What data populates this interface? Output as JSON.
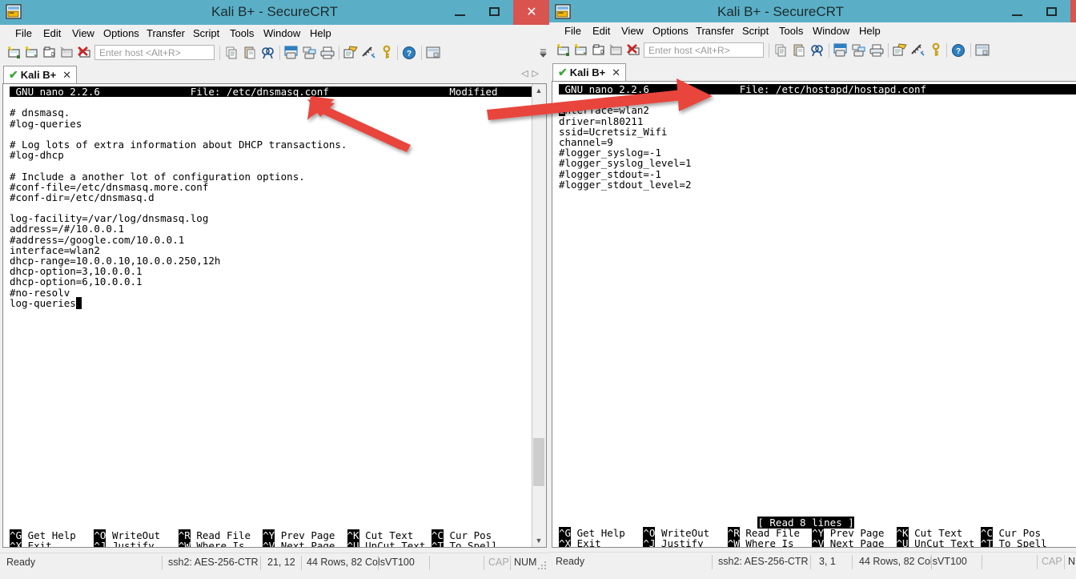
{
  "theme": {
    "titlebar_bg": "#5aafc6",
    "close_btn_bg": "#d9534f",
    "desktop_bg": "#8ec9d8",
    "terminal_bg": "#ffffff",
    "terminal_fg": "#000000",
    "arrow_color": "#e8453c",
    "tab_check_color": "#3aa83a"
  },
  "menu_items": [
    "File",
    "Edit",
    "View",
    "Options",
    "Transfer",
    "Script",
    "Tools",
    "Window",
    "Help"
  ],
  "toolbar": {
    "host_placeholder": "Enter host <Alt+R>",
    "icons": [
      "new-session-icon",
      "clone-session-icon",
      "connect-in-tab-icon",
      "reconnect-icon",
      "disconnect-icon",
      "copy-icon",
      "paste-icon",
      "find-icon",
      "print-screen-icon",
      "log-session-icon",
      "print-icon",
      "session-options-icon",
      "global-options-icon",
      "key-icon",
      "help-icon",
      "chat-window-icon"
    ],
    "overflow_label": "toolbar-overflow-icon"
  },
  "window_buttons": {
    "minimize": "–",
    "maximize": "□",
    "close": "✕"
  },
  "nano_keys": [
    {
      "key": "^G",
      "label": "Get Help"
    },
    {
      "key": "^O",
      "label": "WriteOut"
    },
    {
      "key": "^R",
      "label": "Read File"
    },
    {
      "key": "^Y",
      "label": "Prev Page"
    },
    {
      "key": "^K",
      "label": "Cut Text"
    },
    {
      "key": "^C",
      "label": "Cur Pos"
    },
    {
      "key": "^X",
      "label": "Exit"
    },
    {
      "key": "^J",
      "label": "Justify"
    },
    {
      "key": "^W",
      "label": "Where Is"
    },
    {
      "key": "^V",
      "label": "Next Page"
    },
    {
      "key": "^U",
      "label": "UnCut Text"
    },
    {
      "key": "^T",
      "label": "To Spell"
    }
  ],
  "left_window": {
    "title": "Kali B+ - SecureCRT",
    "tab_label": "Kali B+",
    "tab_close": "✕",
    "nano": {
      "version": "GNU nano 2.2.6",
      "file_label": "File: /etc/dnsmasq.conf",
      "state": "Modified",
      "status_message": "",
      "content": [
        "# dnsmasq.",
        "#log-queries",
        "",
        "# Log lots of extra information about DHCP transactions.",
        "#log-dhcp",
        "",
        "# Include a another lot of configuration options.",
        "#conf-file=/etc/dnsmasq.more.conf",
        "#conf-dir=/etc/dnsmasq.d",
        "",
        "log-facility=/var/log/dnsmasq.log",
        "address=/#/10.0.0.1",
        "#address=/google.com/10.0.0.1",
        "interface=wlan2",
        "dhcp-range=10.0.0.10,10.0.0.250,12h",
        "dhcp-option=3,10.0.0.1",
        "dhcp-option=6,10.0.0.1",
        "#no-resolv",
        "log-queries"
      ],
      "cursor_line": 18,
      "cursor_col": 11
    },
    "statusbar": {
      "ready": "Ready",
      "protocol": "ssh2: AES-256-CTR",
      "position": "21, 12",
      "size": "44 Rows, 82 Cols",
      "emulation": "VT100",
      "blank": "",
      "caps": "CAP",
      "num": "NUM"
    }
  },
  "right_window": {
    "title": "Kali B+ - SecureCRT",
    "tab_label": "Kali B+",
    "tab_close": "✕",
    "nano": {
      "version": "GNU nano 2.2.6",
      "file_label": "File: /etc/hostapd/hostapd.conf",
      "state": "",
      "status_message": "[ Read 8 lines ]",
      "content": [
        "interface=wlan2",
        "driver=nl80211",
        "ssid=Ucretsiz_Wifi",
        "channel=9",
        "#logger_syslog=-1",
        "#logger_syslog_level=1",
        "#logger_stdout=-1",
        "#logger_stdout_level=2"
      ],
      "cursor_line": 0,
      "cursor_col": 0
    },
    "statusbar": {
      "ready": "Ready",
      "protocol": "ssh2: AES-256-CTR",
      "position": "3, 1",
      "size": "44 Rows, 82 Cols",
      "emulation": "VT100",
      "blank": "",
      "caps": "CAP",
      "num": "NUM"
    }
  },
  "annotations": {
    "arrow_left": "arrow-pointing-to-dnsmasq-conf-filename",
    "arrow_right": "arrow-pointing-to-hostapd-conf-filename"
  }
}
